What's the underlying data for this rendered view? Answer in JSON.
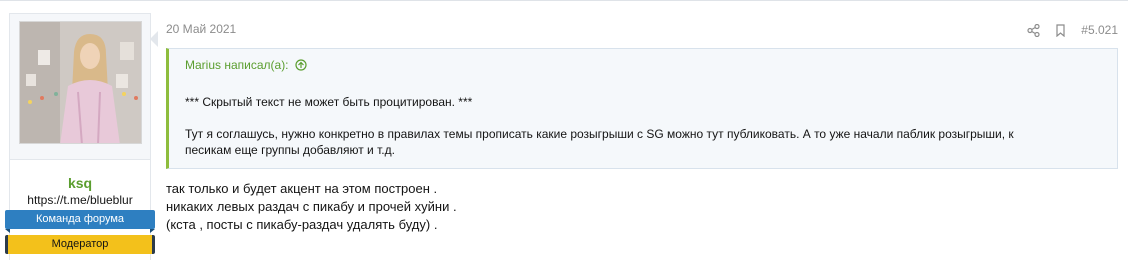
{
  "user": {
    "name": "ksq",
    "title": "https://t.me/blueblur",
    "banners": [
      "Команда форума",
      "Модератор"
    ]
  },
  "post": {
    "date": "20 Май 2021",
    "number": "#5.021",
    "icons": [
      "share-icon",
      "bookmark-icon"
    ]
  },
  "quote": {
    "author": "Marius написал(а):",
    "lines": [
      "*** Скрытый текст не может быть процитирован. ***",
      "Тут я соглашусь, нужно конкретно в правилах темы прописать какие розыгрыши с SG можно тут публиковать. А то уже начали паблик розыгрыши, к",
      "песикам еще группы добавляют и т.д."
    ]
  },
  "message": {
    "lines": [
      "так только и будет акцент на этом построен .",
      "никаких левых раздач с пикабу и прочей хуйни .",
      "(кста , посты с пикабу-раздач удалять буду) ."
    ]
  },
  "colors": {
    "username": "#5b9e2f",
    "team_banner": "#2e7fc1",
    "moderator_banner": "#f3c11b",
    "quote_accent": "#8ebd3d"
  }
}
